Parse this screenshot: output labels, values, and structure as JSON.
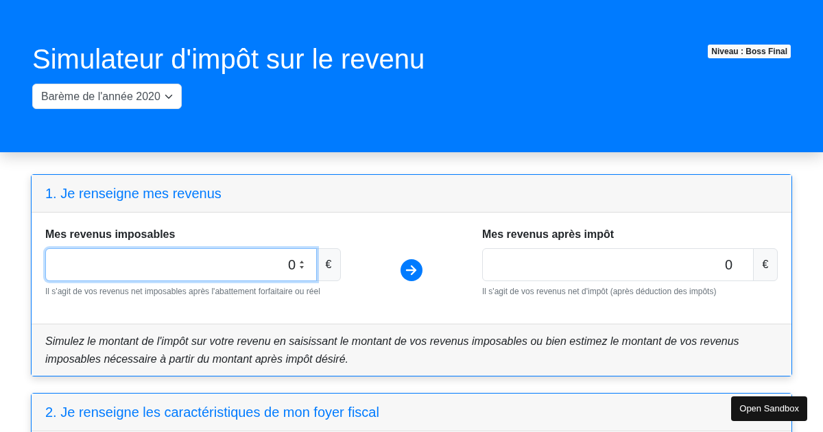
{
  "header": {
    "title": "Simulateur d'impôt sur le revenu",
    "year_select": {
      "value": "Barème de l'année 2020"
    },
    "level_badge": "Niveau : Boss Final"
  },
  "cards": [
    {
      "title": "1. Je renseigne mes revenus",
      "fields": [
        {
          "label": "Mes revenus imposables",
          "value": "0",
          "unit": "€",
          "help": "Il s'agit de vos revenus net imposables après l'abattement forfaitaire ou réel",
          "focused": true
        },
        {
          "label": "Mes revenus après impôt",
          "value": "0",
          "unit": "€",
          "help": "Il s'agit de vos revenus net d'impôt (après déduction des impôts)",
          "focused": false
        }
      ],
      "footer": "Simulez le montant de l'impôt sur votre revenu en saisissant le montant de vos revenus imposables ou bien estimez le montant de vos revenus imposables nécessaire à partir du montant après impôt désiré."
    },
    {
      "title": "2. Je renseigne les caractéristiques de mon foyer fiscal"
    }
  ],
  "sandbox_button": "Open Sandbox"
}
